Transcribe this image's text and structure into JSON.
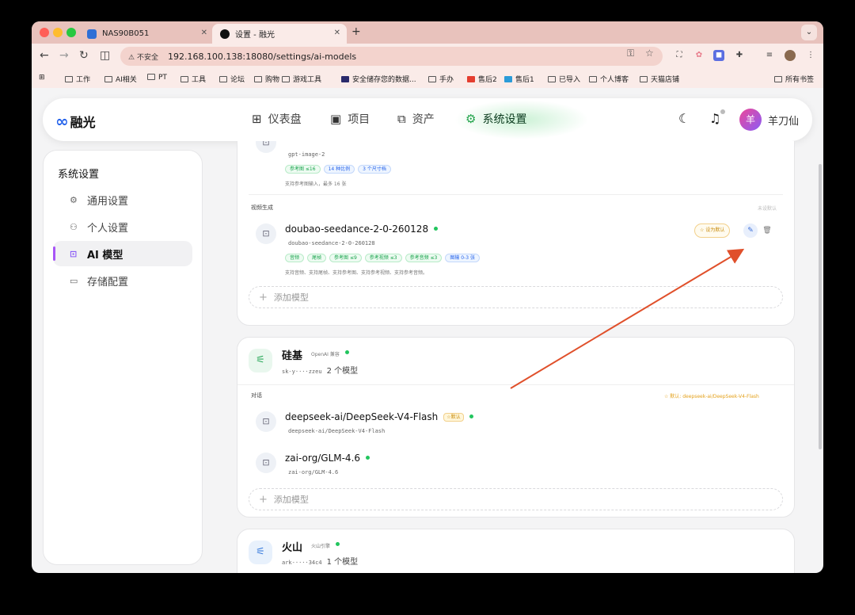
{
  "browser": {
    "tabs": [
      {
        "title": "NAS90B051",
        "close": "✕"
      },
      {
        "title": "设置 - 融光",
        "close": "✕"
      }
    ],
    "new_tab": "+",
    "menu": "⌄",
    "security_label": "不安全",
    "url": "192.168.100.138:18080/settings/ai-models",
    "bookmarks": [
      "工作",
      "AI相关",
      "PT",
      "工具",
      "论坛",
      "购物",
      "游戏工具",
      "安全储存您的数据...",
      "手办",
      "售后2",
      "售后1",
      "已导入",
      "个人博客",
      "天猫店铺"
    ],
    "all_bookmarks": "所有书签"
  },
  "app": {
    "logo": "融光",
    "nav": [
      {
        "label": "仪表盘",
        "icon": "dashboard-icon"
      },
      {
        "label": "项目",
        "icon": "project-icon"
      },
      {
        "label": "资产",
        "icon": "image-icon"
      },
      {
        "label": "系统设置",
        "icon": "gear-icon"
      }
    ],
    "avatar_char": "羊",
    "user_name": "羊刀仙",
    "accent": "#22a34b"
  },
  "sidebar": {
    "title": "系统设置",
    "items": [
      {
        "label": "通用设置",
        "icon": "gear-icon"
      },
      {
        "label": "个人设置",
        "icon": "users-icon"
      },
      {
        "label": "AI 模型",
        "icon": "robot-icon"
      },
      {
        "label": "存储配置",
        "icon": "storage-icon"
      }
    ]
  },
  "card1": {
    "top_model": {
      "id": "gpt-image-2",
      "tags": [
        "参考图 ≤16",
        "14 种比例",
        "3 个尺寸档"
      ],
      "desc": "支持参考图输入，最多 16 张"
    },
    "video_section": "视频生成",
    "video_default_hint": "未设默认",
    "video_model": {
      "name": "doubao-seedance-2-0-260128",
      "id": "doubao-seedance-2-0-260128",
      "tags": [
        "音频",
        "尾帧",
        "参考图 ≤9",
        "参考视频 ≤3",
        "参考音频 ≤3",
        "图输 0-3 张"
      ],
      "desc": "支持音频、支持尾帧、支持参考图、支持参考视频、支持参考音频。",
      "set_default": "设为默认"
    },
    "add_model": "添加模型"
  },
  "card2": {
    "provider": "硅基",
    "type": "OpenAI 兼容",
    "key": "sk-y····zzeu",
    "count": "2 个模型",
    "section": "对话",
    "default_hint": "默认: deepseek-ai/DeepSeek-V4-Flash",
    "models": [
      {
        "name": "deepseek-ai/DeepSeek-V4-Flash",
        "id": "deepseek-ai/DeepSeek-V4-Flash",
        "badge": "默认"
      },
      {
        "name": "zai-org/GLM-4.6",
        "id": "zai-org/GLM-4.6"
      }
    ],
    "add_model": "添加模型"
  },
  "card3": {
    "provider": "火山",
    "type": "火山引擎",
    "key": "ark-····34c4",
    "count": "1 个模型"
  },
  "colors": {
    "arrow": "#e0502b",
    "default_gold": "#e4a11b"
  }
}
